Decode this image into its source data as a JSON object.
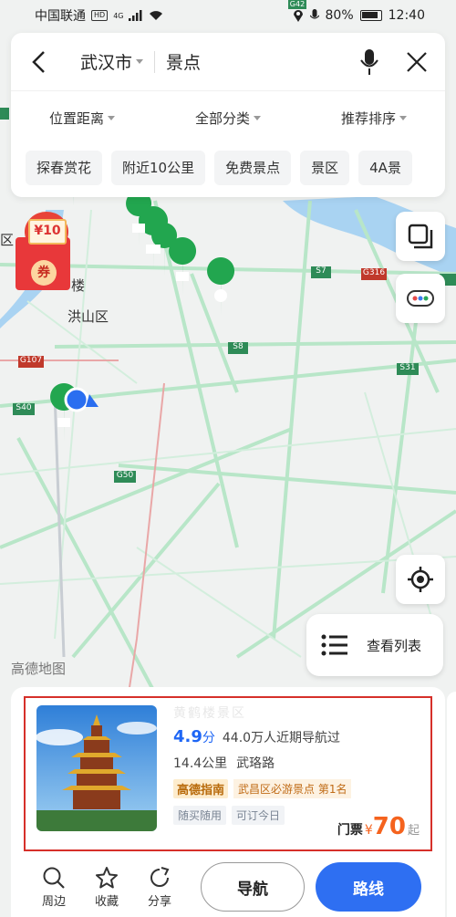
{
  "status": {
    "carrier": "中国联通",
    "hd": "HD",
    "network": "4G",
    "battery": "80%",
    "time": "12:40"
  },
  "search": {
    "city": "武汉市",
    "query": "景点"
  },
  "filters": [
    "位置距离",
    "全部分类",
    "推荐排序"
  ],
  "chips": [
    "探春赏花",
    "附近10公里",
    "免费景点",
    "景区",
    "4A景"
  ],
  "map": {
    "district_label": "洪山区",
    "district_left_label": "区",
    "lou_label": "楼",
    "road_shields": [
      "G42",
      "S7",
      "G316",
      "S8",
      "S31",
      "G107",
      "S40",
      "G50"
    ],
    "watermark": "高德地图"
  },
  "coupon": {
    "amount": "¥10",
    "label": "券"
  },
  "list_button": {
    "label": "查看列表"
  },
  "poi": {
    "name": "黄鹤楼景区",
    "rating": "4.9",
    "rating_unit": "分",
    "nav_count": "44.0万人近期导航过",
    "distance": "14.4公里",
    "address": "武珞路",
    "guide_tag": "高德指南",
    "rank_tag": "武昌区必游景点 第1名",
    "meta_tags": [
      "随买随用",
      "可订今日"
    ],
    "price_label": "门票",
    "price_currency": "¥",
    "price_value": "70",
    "price_suffix": "起"
  },
  "actions": {
    "nearby": "周边",
    "favorite": "收藏",
    "share": "分享",
    "navigate": "导航",
    "route": "路线"
  },
  "colors": {
    "brand_blue": "#2e6ff2",
    "road_green": "#a8e0bf",
    "price_orange": "#f5631e",
    "highlight_red": "#d6302a",
    "poi_green": "#22a64f"
  }
}
